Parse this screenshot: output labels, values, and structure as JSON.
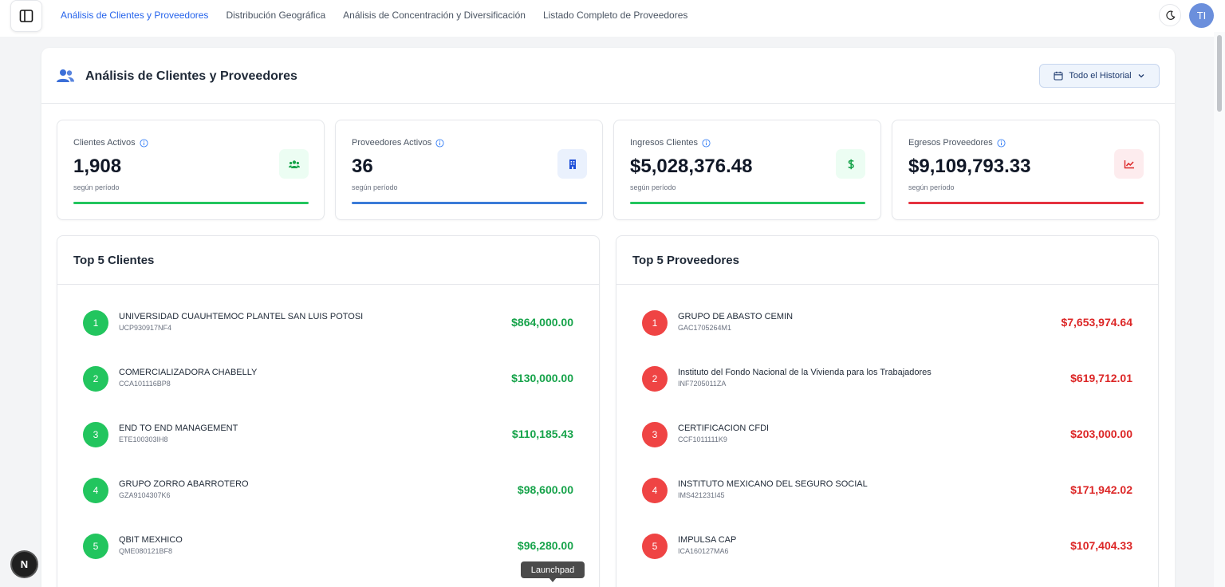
{
  "nav": {
    "tabs": [
      {
        "label": "Análisis de Clientes y Proveedores",
        "active": true
      },
      {
        "label": "Distribución Geográfica",
        "active": false
      },
      {
        "label": "Análisis de Concentración y Diversificación",
        "active": false
      },
      {
        "label": "Listado Completo de Proveedores",
        "active": false
      }
    ],
    "avatar_initials": "TI"
  },
  "header": {
    "title": "Análisis de Clientes y Proveedores",
    "period_label": "Todo el Historial"
  },
  "stats": [
    {
      "label": "Clientes Activos",
      "value": "1,908",
      "sub": "según período",
      "icon": "users-icon",
      "color": "#22c55e"
    },
    {
      "label": "Proveedores Activos",
      "value": "36",
      "sub": "según período",
      "icon": "building-icon",
      "color": "#3b82f6"
    },
    {
      "label": "Ingresos Clientes",
      "value": "$5,028,376.48",
      "sub": "según período",
      "icon": "dollar-icon",
      "color": "#22c55e"
    },
    {
      "label": "Egresos Proveedores",
      "value": "$9,109,793.33",
      "sub": "según período",
      "icon": "trending-icon",
      "color": "#ef4444"
    }
  ],
  "clients": {
    "title": "Top 5 Clientes",
    "items": [
      {
        "rank": "1",
        "name": "UNIVERSIDAD CUAUHTEMOC PLANTEL SAN LUIS POTOSI",
        "rfc": "UCP930917NF4",
        "amount": "$864,000.00"
      },
      {
        "rank": "2",
        "name": "COMERCIALIZADORA CHABELLY",
        "rfc": "CCA101116BP8",
        "amount": "$130,000.00"
      },
      {
        "rank": "3",
        "name": "END TO END MANAGEMENT",
        "rfc": "ETE100303IH8",
        "amount": "$110,185.43"
      },
      {
        "rank": "4",
        "name": "GRUPO ZORRO ABARROTERO",
        "rfc": "GZA9104307K6",
        "amount": "$98,600.00"
      },
      {
        "rank": "5",
        "name": "QBIT MEXHICO",
        "rfc": "QME080121BF8",
        "amount": "$96,280.00"
      }
    ]
  },
  "suppliers": {
    "title": "Top 5 Proveedores",
    "items": [
      {
        "rank": "1",
        "name": "GRUPO DE ABASTO CEMIN",
        "rfc": "GAC1705264M1",
        "amount": "$7,653,974.64"
      },
      {
        "rank": "2",
        "name": "Instituto del Fondo Nacional de la Vivienda para los Trabajadores",
        "rfc": "INF7205011ZA",
        "amount": "$619,712.01"
      },
      {
        "rank": "3",
        "name": "CERTIFICACION CFDI",
        "rfc": "CCF1011111K9",
        "amount": "$203,000.00"
      },
      {
        "rank": "4",
        "name": "INSTITUTO MEXICANO DEL SEGURO SOCIAL",
        "rfc": "IMS421231I45",
        "amount": "$171,942.02"
      },
      {
        "rank": "5",
        "name": "IMPULSA CAP",
        "rfc": "ICA160127MA6",
        "amount": "$107,404.33"
      }
    ]
  },
  "overlay": {
    "badge": "N",
    "tooltip": "Launchpad"
  }
}
